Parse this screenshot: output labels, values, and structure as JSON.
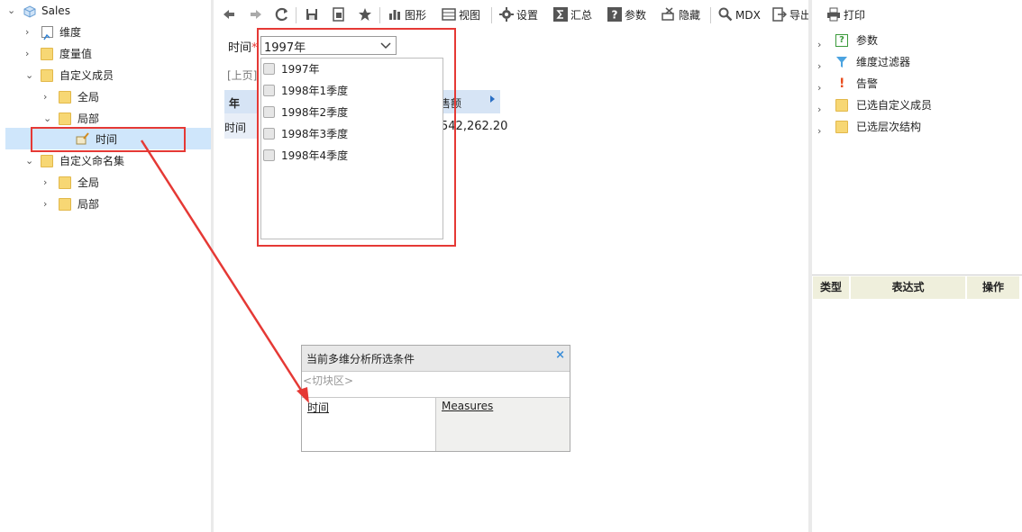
{
  "tree": {
    "root": "Sales",
    "items": [
      {
        "label": "维度"
      },
      {
        "label": "度量值"
      },
      {
        "label": "自定义成员"
      },
      {
        "label": "全局"
      },
      {
        "label": "局部"
      },
      {
        "label": "时间"
      },
      {
        "label": "自定义命名集"
      },
      {
        "label": "全局"
      },
      {
        "label": "局部"
      }
    ]
  },
  "toolbar": {
    "chart": "图形",
    "view": "视图",
    "settings": "设置",
    "summary": "汇总",
    "params": "参数",
    "hide": "隐藏",
    "mdx": "MDX",
    "export": "导出",
    "print": "打印"
  },
  "filter": {
    "label": "时间",
    "required_mark": "*",
    "value": "1997年",
    "options": [
      "1997年",
      "1998年1季度",
      "1998年2季度",
      "1998年3季度",
      "1998年4季度"
    ]
  },
  "grid": {
    "prev_page": "[上页]",
    "head_year": "年",
    "head_sales_fragment": "售额",
    "row_label": "时间",
    "value_fragment": "542,262.20",
    "partial_char": "t"
  },
  "right_panel": {
    "items": [
      {
        "label": "参数"
      },
      {
        "label": "维度过滤器"
      },
      {
        "label": "告警"
      },
      {
        "label": "已选自定义成员"
      },
      {
        "label": "已选层次结构"
      }
    ],
    "table_headers": [
      "类型",
      "表达式",
      "操作"
    ]
  },
  "conditions": {
    "title": "当前多维分析所选条件",
    "close": "×",
    "slicer": "<切块区>",
    "rows_field": "时间",
    "cols_field": "Measures"
  },
  "colors": {
    "highlight": "#e53935",
    "selection": "#cfe6fb",
    "folder": "#f7d774"
  }
}
